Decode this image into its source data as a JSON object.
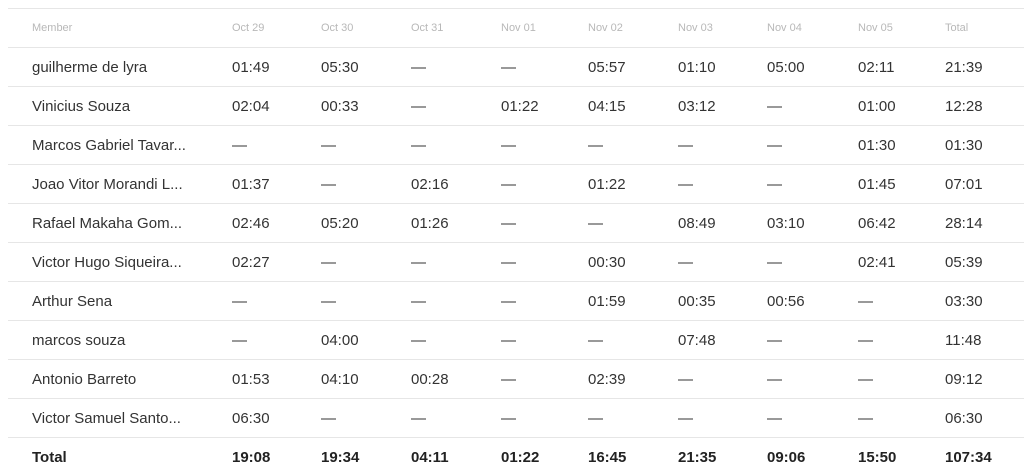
{
  "table": {
    "headers": [
      "Member",
      "Oct 29",
      "Oct 30",
      "Oct 31",
      "Nov 01",
      "Nov 02",
      "Nov 03",
      "Nov 04",
      "Nov 05",
      "Total"
    ],
    "rows": [
      [
        "guilherme de lyra",
        "01:49",
        "05:30",
        "—",
        "—",
        "05:57",
        "01:10",
        "05:00",
        "02:11",
        "21:39"
      ],
      [
        "Vinicius Souza",
        "02:04",
        "00:33",
        "—",
        "01:22",
        "04:15",
        "03:12",
        "—",
        "01:00",
        "12:28"
      ],
      [
        "Marcos Gabriel Tavar...",
        "—",
        "—",
        "—",
        "—",
        "—",
        "—",
        "—",
        "01:30",
        "01:30"
      ],
      [
        "Joao Vitor Morandi L...",
        "01:37",
        "—",
        "02:16",
        "—",
        "01:22",
        "—",
        "—",
        "01:45",
        "07:01"
      ],
      [
        "Rafael Makaha Gom...",
        "02:46",
        "05:20",
        "01:26",
        "—",
        "—",
        "08:49",
        "03:10",
        "06:42",
        "28:14"
      ],
      [
        "Victor Hugo Siqueira...",
        "02:27",
        "—",
        "—",
        "—",
        "00:30",
        "—",
        "—",
        "02:41",
        "05:39"
      ],
      [
        "Arthur Sena",
        "—",
        "—",
        "—",
        "—",
        "01:59",
        "00:35",
        "00:56",
        "—",
        "03:30"
      ],
      [
        "marcos souza",
        "—",
        "04:00",
        "—",
        "—",
        "—",
        "07:48",
        "—",
        "—",
        "11:48"
      ],
      [
        "Antonio Barreto",
        "01:53",
        "04:10",
        "00:28",
        "—",
        "02:39",
        "—",
        "—",
        "—",
        "09:12"
      ],
      [
        "Victor Samuel Santo...",
        "06:30",
        "—",
        "—",
        "—",
        "—",
        "—",
        "—",
        "—",
        "06:30"
      ]
    ],
    "total": [
      "Total",
      "19:08",
      "19:34",
      "04:11",
      "01:22",
      "16:45",
      "21:35",
      "09:06",
      "15:50",
      "107:34"
    ]
  }
}
